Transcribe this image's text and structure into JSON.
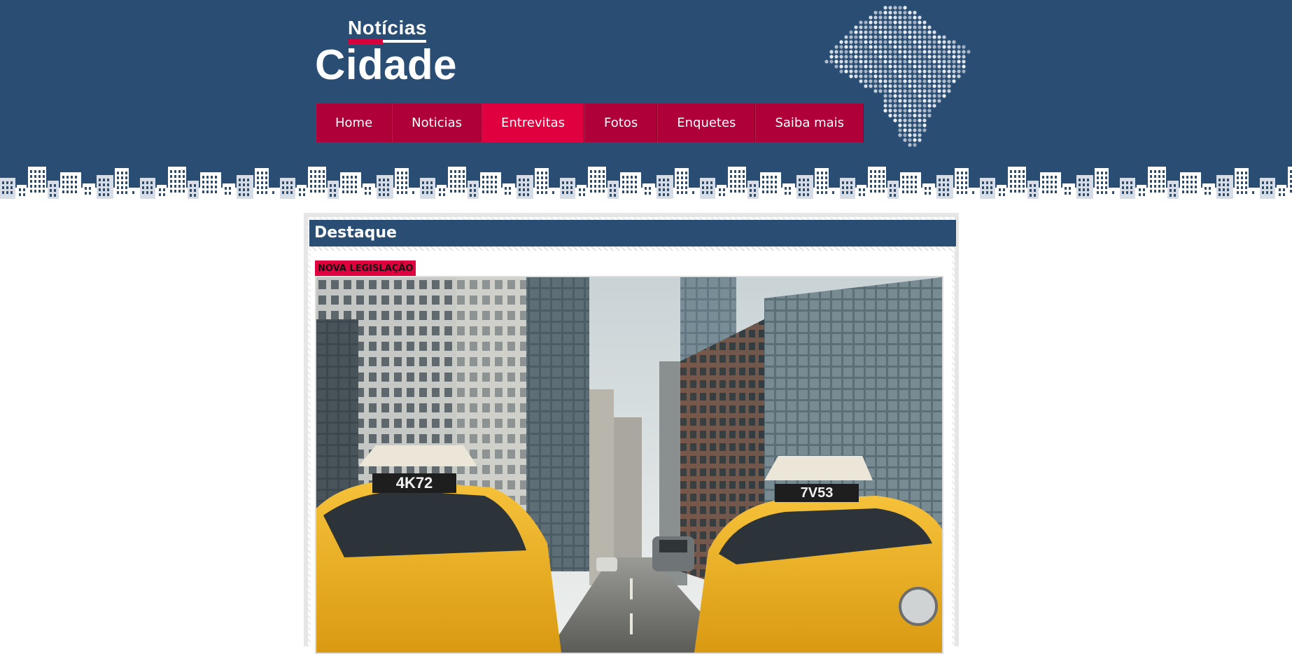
{
  "site": {
    "logo_top": "Notícias",
    "logo_bottom": "Cidade"
  },
  "nav": {
    "items": [
      {
        "label": "Home"
      },
      {
        "label": "Noticias"
      },
      {
        "label": "Entrevitas"
      },
      {
        "label": "Fotos"
      },
      {
        "label": "Enquetes"
      },
      {
        "label": "Saiba mais"
      }
    ],
    "active_index": 2
  },
  "featured": {
    "section_title": "Destaque",
    "tag": "NOVA LEGISLAÇÃO",
    "image_subject": "city street with yellow taxis",
    "taxi_left_sign": "4K72",
    "taxi_right_sign": "7V53"
  },
  "colors": {
    "header_bg": "#2a4d73",
    "nav_bg": "#b0003a",
    "nav_active": "#e0003f",
    "accent_red": "#d6003d",
    "taxi_yellow": "#f2b21f"
  }
}
